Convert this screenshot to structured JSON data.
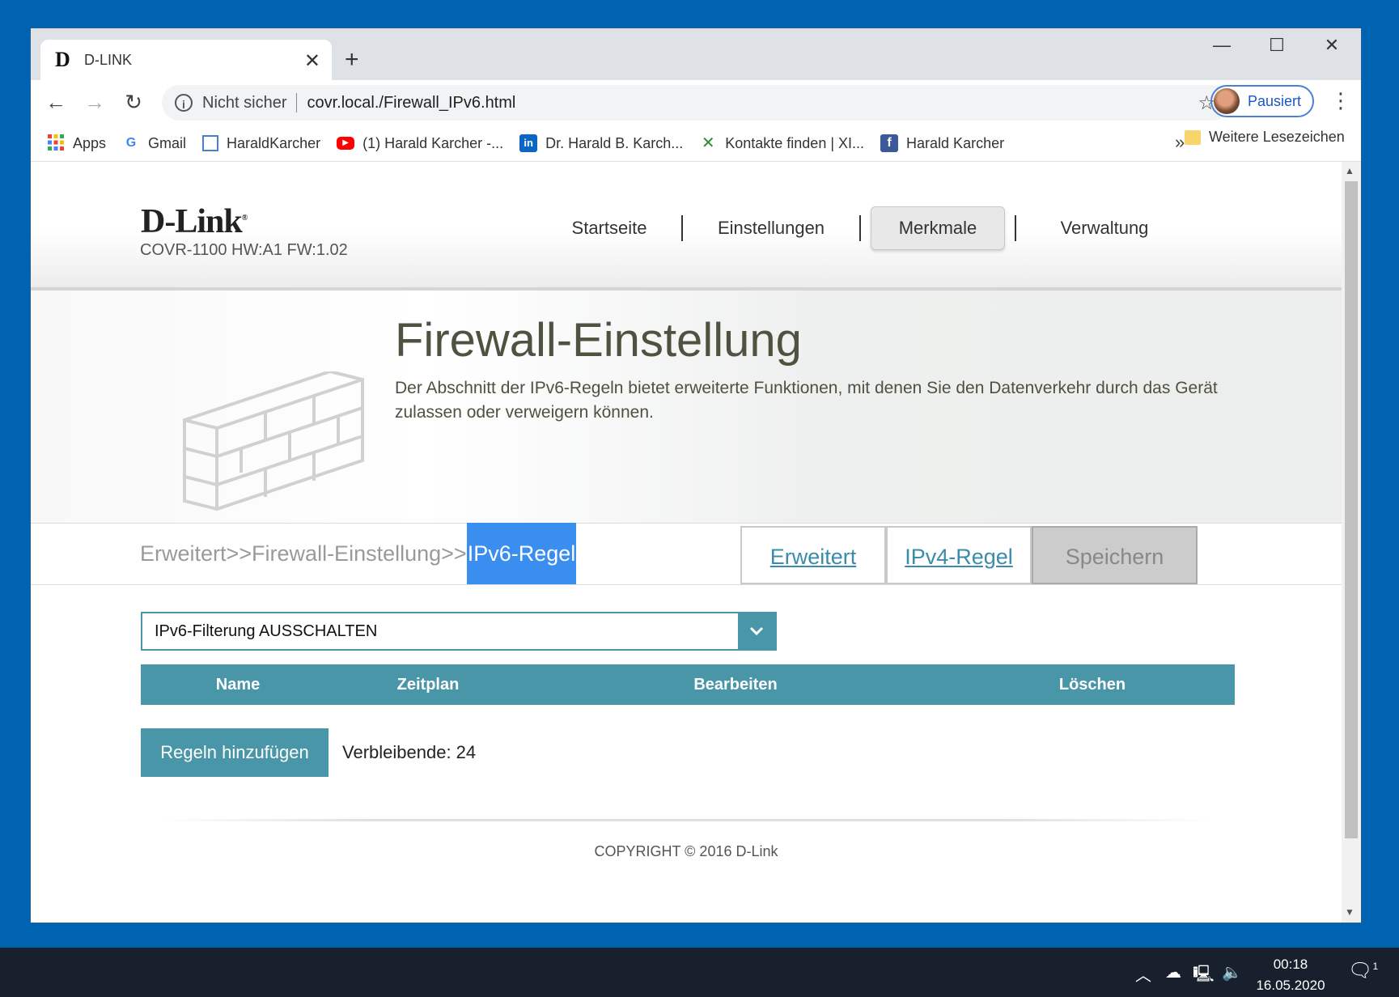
{
  "browser": {
    "tab_title": "D-LINK",
    "tab_favicon": "D",
    "security_label": "Nicht sicher",
    "url": "covr.local./Firewall_IPv6.html",
    "profile_label": "Pausiert"
  },
  "bookmarks": {
    "items": [
      {
        "label": "Apps",
        "icon": "apps-grid-icon"
      },
      {
        "label": "Gmail",
        "icon": "google-icon"
      },
      {
        "label": "HaraldKarcher",
        "icon": "page-icon"
      },
      {
        "label": "(1) Harald Karcher -...",
        "icon": "youtube-icon"
      },
      {
        "label": "Dr. Harald B. Karch...",
        "icon": "linkedin-icon"
      },
      {
        "label": "Kontakte finden | XI...",
        "icon": "xing-icon"
      },
      {
        "label": "Harald Karcher",
        "icon": "facebook-icon"
      }
    ],
    "more": "»",
    "folder_label": "Weitere Lesezeichen"
  },
  "header": {
    "logo": "D-Link",
    "model": "COVR-1100 HW:A1 FW:1.02",
    "nav": [
      "Startseite",
      "Einstellungen",
      "Merkmale",
      "Verwaltung"
    ],
    "active_nav": "Merkmale"
  },
  "banner": {
    "title": "Firewall-Einstellung",
    "description": "Der Abschnitt der IPv6-Regeln bietet erweiterte Funktionen, mit denen Sie den Datenverkehr durch das Gerät zulassen oder verweigern können."
  },
  "breadcrumb": {
    "path": "Erweitert>>Firewall-Einstellung>>",
    "current": "IPv6-Regel"
  },
  "actions": {
    "advanced": "Erweitert",
    "ipv4": "IPv4-Regel",
    "save": "Speichern"
  },
  "filter": {
    "selected": "IPv6-Filterung AUSSCHALTEN"
  },
  "table": {
    "columns": [
      "Name",
      "Zeitplan",
      "Bearbeiten",
      "Löschen"
    ],
    "rows": []
  },
  "rules": {
    "add_label": "Regeln hinzufügen",
    "remaining": "Verbleibende: 24"
  },
  "footer": {
    "copyright": "COPYRIGHT © 2016 D-Link"
  },
  "taskbar": {
    "time": "00:18",
    "date": "16.05.2020",
    "notifications": "1"
  },
  "colors": {
    "desktop": "#0063b1",
    "accent": "#4996a8",
    "crumb_highlight": "#3a8ef0",
    "banner_title": "#4f5240"
  }
}
